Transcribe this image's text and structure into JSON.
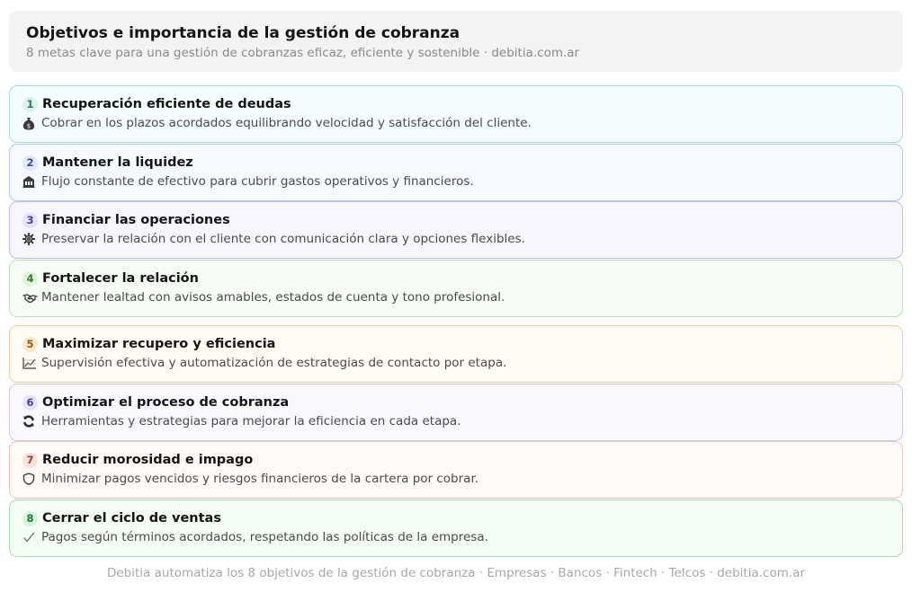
{
  "header": {
    "title": "Objetivos e importancia de la gestión de cobranza",
    "subtitle": "8 metas clave para una gestión de cobranzas eficaz, eficiente y sostenible · debitia.com.ar"
  },
  "items": [
    {
      "number": "1",
      "title": "Recuperación eficiente de deudas",
      "description": "Cobrar en los plazos acordados equilibrando velocidad y satisfacción del cliente.",
      "icon": "money-bag-icon",
      "bg": "#f4fcfd",
      "border": "#9edfd4",
      "badge_bg": "#dcf3ec",
      "badge_fg": "#1f7a5c"
    },
    {
      "number": "2",
      "title": "Mantener la liquidez",
      "description": "Flujo constante de efectivo para cubrir gastos operativos y financieros.",
      "icon": "bank-icon",
      "bg": "#f6f9ff",
      "border": "#b7c9ee",
      "badge_bg": "#e1e9fb",
      "badge_fg": "#2e4f94"
    },
    {
      "number": "3",
      "title": "Financiar las operaciones",
      "description": "Preservar la relación con el cliente con comunicación clara y opciones flexibles.",
      "icon": "gear-icon",
      "bg": "#f7f6ff",
      "border": "#c3bdf0",
      "badge_bg": "#e5e1fa",
      "badge_fg": "#4b3f9a"
    },
    {
      "number": "4",
      "title": "Fortalecer la relación",
      "description": "Mantener lealtad con avisos amables, estados de cuenta y tono profesional.",
      "icon": "handshake-icon",
      "bg": "#f6fdf4",
      "border": "#b6e3b0",
      "badge_bg": "#e0f3da",
      "badge_fg": "#3a7a2c"
    },
    {
      "number": "5",
      "title": "Maximizar recupero y eficiencia",
      "description": "Supervisión efectiva y automatización de estrategias de contacto por etapa.",
      "icon": "chart-icon",
      "bg": "#fffbf4",
      "border": "#f3cf98",
      "badge_bg": "#fbe9cc",
      "badge_fg": "#9a5d10"
    },
    {
      "number": "6",
      "title": "Optimizar el proceso de cobranza",
      "description": "Herramientas y estrategias para mejorar la eficiencia en cada etapa.",
      "icon": "refresh-icon",
      "bg": "#f9f8ff",
      "border": "#cfc7f1",
      "badge_bg": "#e7e3fa",
      "badge_fg": "#4a3f99"
    },
    {
      "number": "7",
      "title": "Reducir morosidad e impago",
      "description": "Minimizar pagos vencidos y riesgos financieros de la cartera por cobrar.",
      "icon": "shield-icon",
      "bg": "#fffaf8",
      "border": "#f1c4b8",
      "badge_bg": "#fbe3dc",
      "badge_fg": "#a2412a"
    },
    {
      "number": "8",
      "title": "Cerrar el ciclo de ventas",
      "description": "Pagos según términos acordados, respetando las políticas de la empresa.",
      "icon": "check-icon",
      "bg": "#f4fcf6",
      "border": "#a9dcb5",
      "badge_bg": "#d9f1df",
      "badge_fg": "#1f7a3a"
    }
  ],
  "footer": {
    "text": "Debitia automatiza los 8 objetivos de la gestión de cobranza · Empresas · Bancos · Fintech · Telcos · debitia.com.ar"
  }
}
